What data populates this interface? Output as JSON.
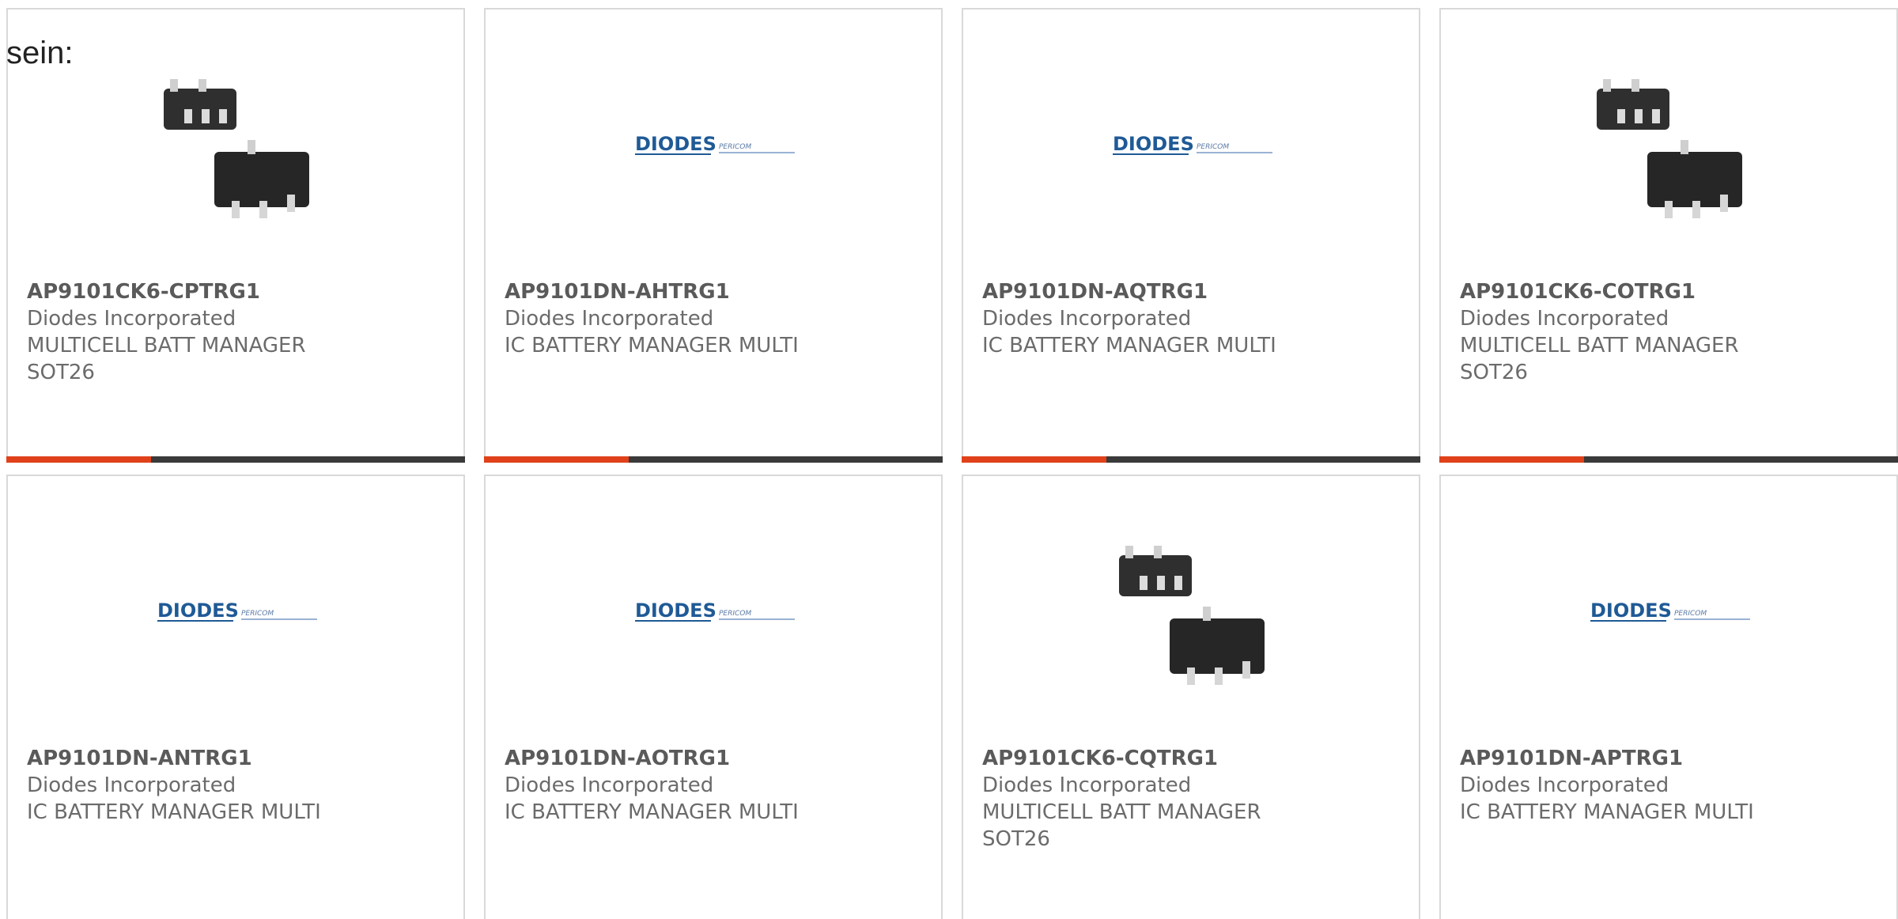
{
  "intro_text": "sein:",
  "colors": {
    "accent": "#e0411a",
    "bar": "#3a3a3a",
    "card_border": "#d9d9d9",
    "logo_blue": "#1f5a96"
  },
  "products": [
    {
      "part_number": "AP9101CK6-CPTRG1",
      "manufacturer": "Diodes Incorporated",
      "description": "MULTICELL BATT MANAGER SOT26",
      "image": "sot26-package-image"
    },
    {
      "part_number": "AP9101DN-AHTRG1",
      "manufacturer": "Diodes Incorporated",
      "description": "IC BATTERY MANAGER MULTI",
      "image": "diodes-pericom-logo",
      "logo_text": "DIODES",
      "logo_sub": "PERICOM"
    },
    {
      "part_number": "AP9101DN-AQTRG1",
      "manufacturer": "Diodes Incorporated",
      "description": "IC BATTERY MANAGER MULTI",
      "image": "diodes-pericom-logo",
      "logo_text": "DIODES",
      "logo_sub": "PERICOM"
    },
    {
      "part_number": "AP9101CK6-COTRG1",
      "manufacturer": "Diodes Incorporated",
      "description": "MULTICELL BATT MANAGER SOT26",
      "image": "sot26-package-image"
    },
    {
      "part_number": "AP9101DN-ANTRG1",
      "manufacturer": "Diodes Incorporated",
      "description": "IC BATTERY MANAGER MULTI",
      "image": "diodes-pericom-logo",
      "logo_text": "DIODES",
      "logo_sub": "PERICOM"
    },
    {
      "part_number": "AP9101DN-AOTRG1",
      "manufacturer": "Diodes Incorporated",
      "description": "IC BATTERY MANAGER MULTI",
      "image": "diodes-pericom-logo",
      "logo_text": "DIODES",
      "logo_sub": "PERICOM"
    },
    {
      "part_number": "AP9101CK6-CQTRG1",
      "manufacturer": "Diodes Incorporated",
      "description": "MULTICELL BATT MANAGER SOT26",
      "image": "sot26-package-image"
    },
    {
      "part_number": "AP9101DN-APTRG1",
      "manufacturer": "Diodes Incorporated",
      "description": "IC BATTERY MANAGER MULTI",
      "image": "diodes-pericom-logo",
      "logo_text": "DIODES",
      "logo_sub": "PERICOM"
    }
  ]
}
